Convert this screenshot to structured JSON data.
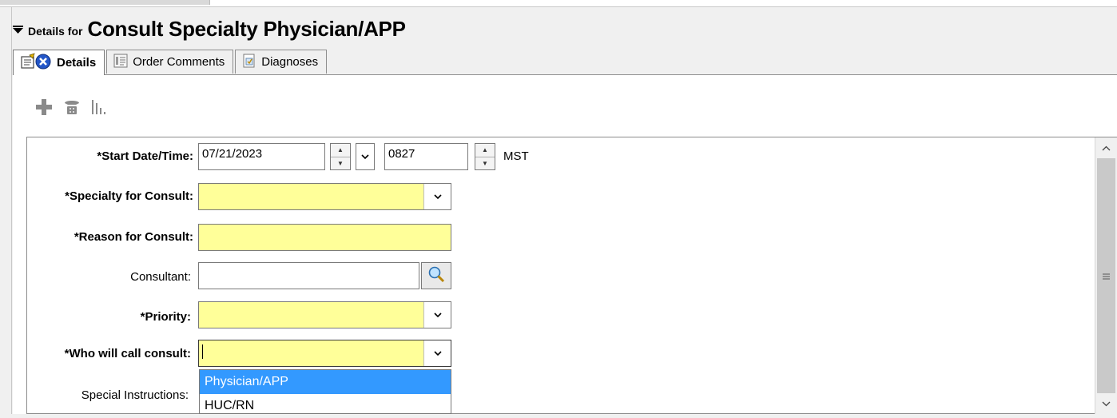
{
  "header": {
    "prefix": "Details for",
    "title": "Consult Specialty Physician/APP"
  },
  "tabs": [
    {
      "label": "Details",
      "active": true,
      "icon": "details-icon"
    },
    {
      "label": "Order Comments",
      "active": false,
      "icon": "comments-icon"
    },
    {
      "label": "Diagnoses",
      "active": false,
      "icon": "diagnoses-icon"
    }
  ],
  "toolbar": {
    "icons": [
      "add-icon",
      "phone-icon",
      "chart-icon"
    ]
  },
  "form": {
    "start_date_label": "*Start Date/Time:",
    "start_date_value": "07/21/2023",
    "start_time_value": "0827",
    "timezone": "MST",
    "specialty_label": "*Specialty for Consult:",
    "specialty_value": "",
    "reason_label": "*Reason for Consult:",
    "reason_value": "",
    "consultant_label": "Consultant:",
    "consultant_value": "",
    "priority_label": "*Priority:",
    "priority_value": "",
    "who_call_label": "*Who will call consult:",
    "who_call_value": "",
    "special_instructions_label": "Special Instructions:"
  },
  "dropdown": {
    "options": [
      "Physician/APP",
      "HUC/RN"
    ],
    "highlighted_index": 0
  },
  "colors": {
    "required_field": "#ffff99",
    "selection": "#3399ff"
  }
}
